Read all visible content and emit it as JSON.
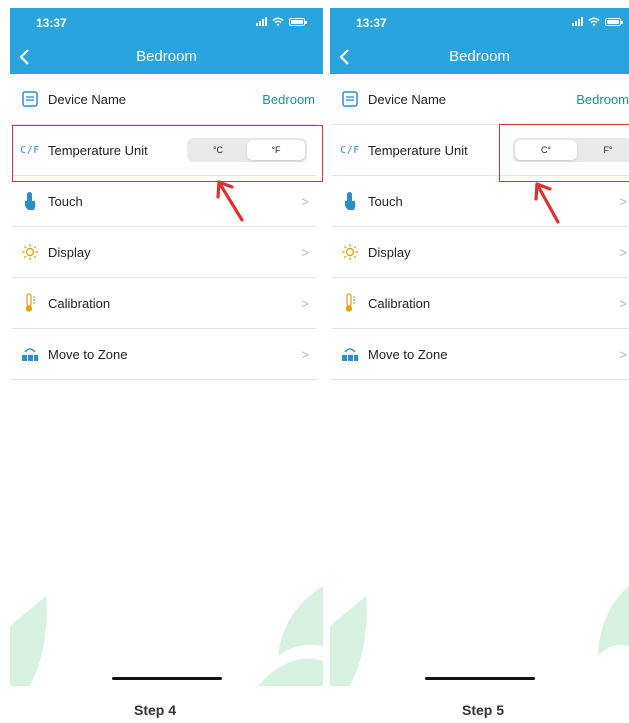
{
  "screens": [
    {
      "status_time": "13:37",
      "title": "Bedroom",
      "rows": {
        "device_name": {
          "label": "Device Name",
          "value": "Bedroom"
        },
        "temperature_unit": {
          "label": "Temperature Unit",
          "icon_text": "C/F",
          "options": [
            "°C",
            "°F"
          ],
          "selected": "°F"
        },
        "touch": {
          "label": "Touch",
          "chevron": ">"
        },
        "display": {
          "label": "Display",
          "chevron": ">"
        },
        "calibration": {
          "label": "Calibration",
          "chevron": ">"
        },
        "move_to_zone": {
          "label": "Move to Zone",
          "chevron": ">"
        }
      },
      "caption": "Step 4"
    },
    {
      "status_time": "13:37",
      "title": "Bedroom",
      "rows": {
        "device_name": {
          "label": "Device Name",
          "value": "Bedroom"
        },
        "temperature_unit": {
          "label": "Temperature Unit",
          "icon_text": "C/F",
          "options": [
            "C°",
            "F°"
          ],
          "selected": "C°"
        },
        "touch": {
          "label": "Touch",
          "chevron": ">"
        },
        "display": {
          "label": "Display",
          "chevron": ">"
        },
        "calibration": {
          "label": "Calibration",
          "chevron": ">"
        },
        "move_to_zone": {
          "label": "Move to Zone",
          "chevron": ">"
        }
      },
      "caption": "Step 5"
    }
  ],
  "colors": {
    "header": "#2aa4dc",
    "accent_value": "#1f8f9a",
    "highlight": "#e03030",
    "leaf": "#d6f1df"
  },
  "icons": {
    "back": "chevron-left-icon",
    "device_name": "device-icon",
    "touch": "touch-hand-icon",
    "display": "sun-icon",
    "calibration": "thermometer-icon",
    "move_to_zone": "zone-icon"
  }
}
